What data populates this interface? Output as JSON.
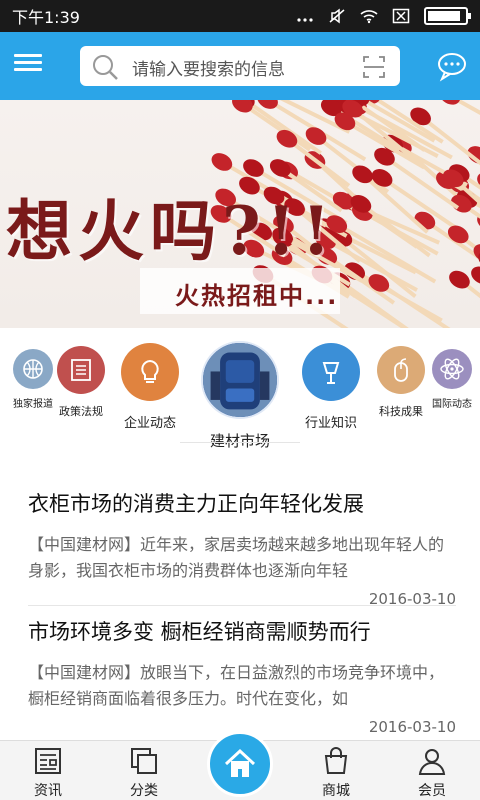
{
  "status_bar": {
    "time": "下午1:39"
  },
  "header": {
    "search_placeholder": "请输入要搜索的信息"
  },
  "banner": {
    "headline": "想火吗?!!",
    "subline": "火热招租中..."
  },
  "categories": [
    {
      "label": "独家报道",
      "icon": "basketball-icon",
      "color": "#8aa8c6"
    },
    {
      "label": "政策法规",
      "icon": "document-icon",
      "color": "#c0504e"
    },
    {
      "label": "企业动态",
      "icon": "bulb-icon",
      "color": "#e0833f"
    },
    {
      "label": "建材市场",
      "icon": "photo-backpack",
      "color": "#2b5aa6"
    },
    {
      "label": "行业知识",
      "icon": "mic-icon",
      "color": "#3b8fd7"
    },
    {
      "label": "科技成果",
      "icon": "mouse-icon",
      "color": "#dcaa76"
    },
    {
      "label": "国际动态",
      "icon": "atom-icon",
      "color": "#9b8fbf"
    }
  ],
  "articles": [
    {
      "title": "衣柜市场的消费主力正向年轻化发展",
      "summary": "【中国建材网】近年来，家居卖场越来越多地出现年轻人的身影，我国衣柜市场的消费群体也逐渐向年轻",
      "date": "2016-03-10"
    },
    {
      "title": "市场环境多变 橱柜经销商需顺势而行",
      "summary": "【中国建材网】放眼当下，在日益激烈的市场竞争环境中，橱柜经销商面临着很多压力。时代在变化，如",
      "date": "2016-03-10"
    }
  ],
  "tabs": [
    {
      "label": "资讯",
      "icon": "news-icon"
    },
    {
      "label": "分类",
      "icon": "category-icon"
    },
    {
      "label": "",
      "icon": "home-icon"
    },
    {
      "label": "商城",
      "icon": "shop-bag-icon"
    },
    {
      "label": "会员",
      "icon": "user-icon"
    }
  ],
  "colors": {
    "primary": "#2ba5e8",
    "statusbar": "#1a1a1a"
  }
}
